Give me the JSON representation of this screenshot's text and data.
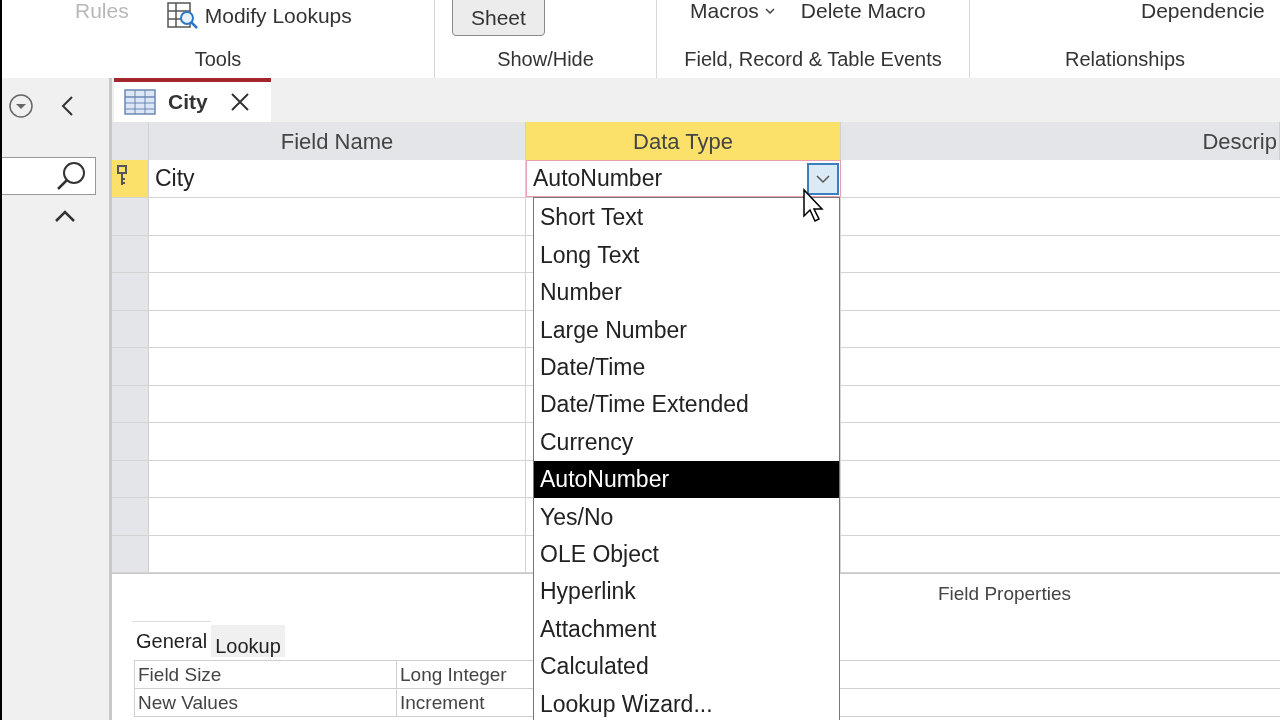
{
  "ribbon": {
    "groups": [
      {
        "label": "Tools",
        "items": [
          {
            "label": "Rules",
            "kind": "text",
            "disabled": true
          },
          {
            "label": "Modify Lookups",
            "kind": "icon",
            "disabled": false
          }
        ]
      },
      {
        "label": "Show/Hide",
        "items": [
          {
            "label": "Sheet",
            "kind": "button",
            "disabled": false
          }
        ]
      },
      {
        "label": "Field, Record & Table Events",
        "items": [
          {
            "label": "Macros",
            "kind": "menu",
            "disabled": false
          },
          {
            "label": "Delete Macro",
            "kind": "text",
            "disabled": false
          }
        ]
      },
      {
        "label": "Relationships",
        "items": [
          {
            "label": "Dependencie",
            "kind": "text",
            "disabled": false
          }
        ]
      }
    ]
  },
  "document_tab": {
    "label": "City"
  },
  "table": {
    "columns": [
      {
        "label": "Field Name",
        "selected": false
      },
      {
        "label": "Data Type",
        "selected": true
      },
      {
        "label": "Descrip",
        "selected": false
      }
    ],
    "rows": [
      {
        "field_name": "City",
        "data_type": "AutoNumber",
        "primary_key": true,
        "selected": true
      }
    ]
  },
  "dropdown": {
    "options": [
      {
        "label": "Short Text",
        "selected": false
      },
      {
        "label": "Long Text",
        "selected": false
      },
      {
        "label": "Number",
        "selected": false
      },
      {
        "label": "Large Number",
        "selected": false
      },
      {
        "label": "Date/Time",
        "selected": false
      },
      {
        "label": "Date/Time Extended",
        "selected": false
      },
      {
        "label": "Currency",
        "selected": false
      },
      {
        "label": "AutoNumber",
        "selected": true
      },
      {
        "label": "Yes/No",
        "selected": false
      },
      {
        "label": "OLE Object",
        "selected": false
      },
      {
        "label": "Hyperlink",
        "selected": false
      },
      {
        "label": "Attachment",
        "selected": false
      },
      {
        "label": "Calculated",
        "selected": false
      },
      {
        "label": "Lookup Wizard...",
        "selected": false
      }
    ]
  },
  "field_properties": {
    "title": "Field Properties",
    "tabs": [
      {
        "label": "General",
        "selected": true
      },
      {
        "label": "Lookup",
        "selected": false
      }
    ],
    "properties": [
      {
        "name": "Field Size",
        "value": "Long Integer"
      },
      {
        "name": "New Values",
        "value": "Increment"
      }
    ]
  }
}
